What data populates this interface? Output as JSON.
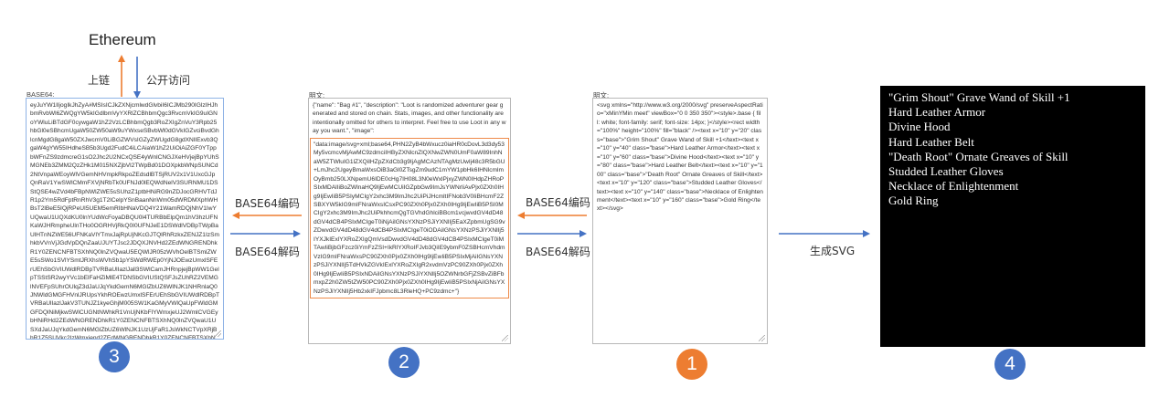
{
  "colors": {
    "blue": "#4472c4",
    "orange": "#ed7d31",
    "highlight": "#ee8a49",
    "circle_blue": "#4472c4",
    "circle_orange": "#ed7d31"
  },
  "top": {
    "title": "Ethereum",
    "up_label": "上链",
    "down_label": "公开访问"
  },
  "panel3": {
    "label": "BASE64:",
    "text": "eyJuYW1lIjogIkJhZyA#MSIsICJkZXNjcmlwdGlvbiI6ICJMb290IGlzIHJhbmRvbWl6ZWQgYW5kIGdlbmVyYXRlZCBhbmQgc3RvcmVkIG9uIGNoYWluLiBTdGF0cywgaW1hZ2VzLCBhbmQgb3RoZXIgZnVuY3Rpb25hbGl0eSBhcmUgaW50ZW50aW9uYWxseSBvbWl0dGVkIGZvciBvdGhlcnMgdG8gaW50ZXJwcmV0LiBGZWVsIGZyZWUgdG8gdXNlIExvb3QgaW4gYW55IHdheSB5b3Ugd2FudC4iLCAiaW1hZ2UiOiAiZGF0YTppbWFnZS9zdmcreG1sO2Jhc2U2NCxQSE4yWnlCNGJXeHVjejBpYUhSMGNEb3ZMM2QzZHk1M015NXZjbVl2TWpBd01DOXpkbWNpSUNCd2NtVnpaWEoyWlVGemNHVmpkRkpoZEdsdlBTSjRUV2x1V1UxcGJpQnRaV1YwSWlCMmFXVjNRbTk0UFNJd0lEQWdNelV3SURNMU1DSStQSE4wZVd4bFBpNWlZWE5sSUhzZ1ptbHNiRG9nZDJocGRHVTdJR1p2Ym5RdFptRnRhV3g1T2lCelpYSnBaanNnWm05dWRDMXphWHBsT2lBeE5IQjRPeUI5UEM5emRIbHNaVDQ4Y21WamRDQjNhV1IwYUQwaU1UQXdKU0lnYUdWcFoyaDBQU0l4TURBbElpQm1hV3hzUFNKaWJHRmpheUlnTHo0OGRHVjRkQ0I0UFNJeE1DSWdlVDBpTWpBaUlHTnNZWE56UFNKaVlYTmxJajRpUjNKcGJTQlRhRzkxZENJZ1IzSmhkbVVnVjJGdVpDQnZaaUJUYTJsc2JDQXJNVHd2ZEdWNGRENDhkR1Y0ZENCNFBTSXhNQ0lnZVQwaU5EQWlJR05zWVhOelBTSmlZWE5sSWo1SVlYSmtJRXhsWVhSb1pYSWdRWEp0YjNJOEwzUmxlSFErUEhSbGVIUWdlRDBpTVRBaUlIazlJall3SWlCamJHRnpjejBpWW1GelpTSStSR2wyYVc1bElFaHZiMlE4TDNSbGVIUStQSFJsZUhRZ2VEMGlNVEFpSUhrOUlqZ3dJaUJqYkdGemN6MGlZbUZ6WlNJK1NHRnlaQ0JNWldGMGFHVnlJRUpsYkhROEwzUmxlSFErUEhSbGVIUWdlRDBpTVRBaUlIazlJakV3TUNJZ1kyeGhjM005SW1KaGMyVWlQaUpFWldGMGFDQlNiMjkwSWlCUGNtNWhkR1VnUjNKbFlYWmxjeUJ2WmlCVGEybHNiRHd2ZEdWNGRENDhkR1Y0ZENCNFBTSXhNQ0lnZVQwaU1USXdJaUJqYkdGemN6MGlZbUZ6WlNJK1UzUjFaR1JsWkNCTVpXRjBhR1Z5SUVkc2IzWmxjend2ZEdWNGRENDhkR1Y0ZENCNFBTSXhNQ0lnZVQwaU1UUXdJaUJqYkdGemN6MGlZbUZ6WlNJK1RtVmphMnhoWTJVZ2IyWWdSVzVzYVdkb2RHVnViV1Z1ZER3dmRHVjRkRDQ4ZEdWNGRDQjRQU0l4TUNJZ2VUMGlNVFl3SWlCamJHRnpjejBpWW1GelpTSStSMjlzWkNCU2FXNW5QQzkwWlhoMFBqd3ZjM1puUGc9PSJ9"
  },
  "panel2": {
    "label": "明文:",
    "text_plain": "{\"name\": \"Bag #1\", \"description\": \"Loot is randomized adventurer gear generated and stored on chain. Stats, images, and other functionality are intentionally omitted for others to interpret. Feel free to use Loot in any way you want.\", \"image\":",
    "text_highlight": "\"data:image/svg+xml;base64,PHN2ZyB4bWxucz0iaHR0cDovL3d3dy53My5vcmcvMjAwMC9zdmciIHByZXNlcnZlQXNwZWN0UmF0aW89InhNaW5ZTWluIG1lZXQiIHZpZXdCb3g9IjAgMCAzNTAgMzUwIj48c3R5bGU+LmJhc2UgeyBmaWxsOiB3aGl0ZTsgZm9udC1mYW1pbHk6IHNlcmlmOyBmb250LXNpemU6IDE0cHg7IH08L3N0eWxlPjxyZWN0IHdpZHRoPSIxMDAlIiBoZWlnaHQ9IjEwMCUiIGZpbGw9ImJsYWNrIiAvPjx0ZXh0IHg9IjEwIiB5PSIyMCIgY2xhc3M9ImJhc2UiPiJHcmltIFNob3V0IiBHcmF2ZSBXYW5kIG9mIFNraWxsICsxPC90ZXh0Pjx0ZXh0IHg9IjEwIiB5PSI0MCIgY2xhc3M9ImJhc2UiPkhhcmQgTGVhdGhlciBBcm1vcjwvdGV4dD48dGV4dCB4PSIxMCIgeT0iNjAiIGNsYXNzPSJiYXNlIj5EaXZpbmUgSG9vZDwvdGV4dD48dGV4dCB4PSIxMCIgeT0iODAiIGNsYXNzPSJiYXNlIj5IYXJkIExlYXRoZXIgQmVsdDwvdGV4dD48dGV4dCB4PSIxMCIgeT0iMTAwIiBjbGFzcz0iYmFzZSI+IkRlYXRoIFJvb3QiIE9ybmF0ZSBHcmVhdmVzIG9mIFNraWxsPC90ZXh0Pjx0ZXh0IHg9IjEwIiB5PSIxMjAiIGNsYXNzPSJiYXNlIj5TdHVkZGVkIExlYXRoZXIgR2xvdmVzPC90ZXh0Pjx0ZXh0IHg9IjEwIiB5PSIxNDAiIGNsYXNzPSJiYXNlIj5OZWNrbGFjZSBvZiBFbmxpZ2h0ZW5tZW50PC90ZXh0Pjx0ZXh0IHg9IjEwIiB5PSIxNjAiIGNsYXNzPSJiYXNlIj5Hb2xkIFJpbmc8L3RleHQ+PC9zdmc+\"}"
  },
  "panel1": {
    "label": "明文:",
    "text": "<svg xmlns=\"http://www.w3.org/2000/svg\" preserveAspectRatio=\"xMinYMin meet\" viewBox=\"0 0 350 350\"><style>.base { fill: white; font-family: serif; font-size: 14px; }</style><rect width=\"100%\" height=\"100%\" fill=\"black\" /><text x=\"10\" y=\"20\" class=\"base\">\"Grim Shout\" Grave Wand of Skill +1</text><text x=\"10\" y=\"40\" class=\"base\">Hard Leather Armor</text><text x=\"10\" y=\"60\" class=\"base\">Divine Hood</text><text x=\"10\" y=\"80\" class=\"base\">Hard Leather Belt</text><text x=\"10\" y=\"100\" class=\"base\">\"Death Root\" Ornate Greaves of Skill</text><text x=\"10\" y=\"120\" class=\"base\">Studded Leather Gloves</text><text x=\"10\" y=\"140\" class=\"base\">Necklace of Enlightenment</text><text x=\"10\" y=\"160\" class=\"base\">Gold Ring</text></svg>"
  },
  "panel4": {
    "items": [
      "\"Grim Shout\" Grave Wand of Skill +1",
      "Hard Leather Armor",
      "Divine Hood",
      "Hard Leather Belt",
      "\"Death Root\" Ornate Greaves of Skill",
      "Studded Leather Gloves",
      "Necklace of Enlightenment",
      "Gold Ring"
    ]
  },
  "arrows": {
    "encode_left": "BASE64编码",
    "decode_left": "BASE64解码",
    "encode_right": "BASE64编码",
    "decode_right": "BASE64解码",
    "render": "生成SVG"
  },
  "steps": {
    "step3": "3",
    "step2": "2",
    "step1": "1",
    "step4": "4"
  }
}
